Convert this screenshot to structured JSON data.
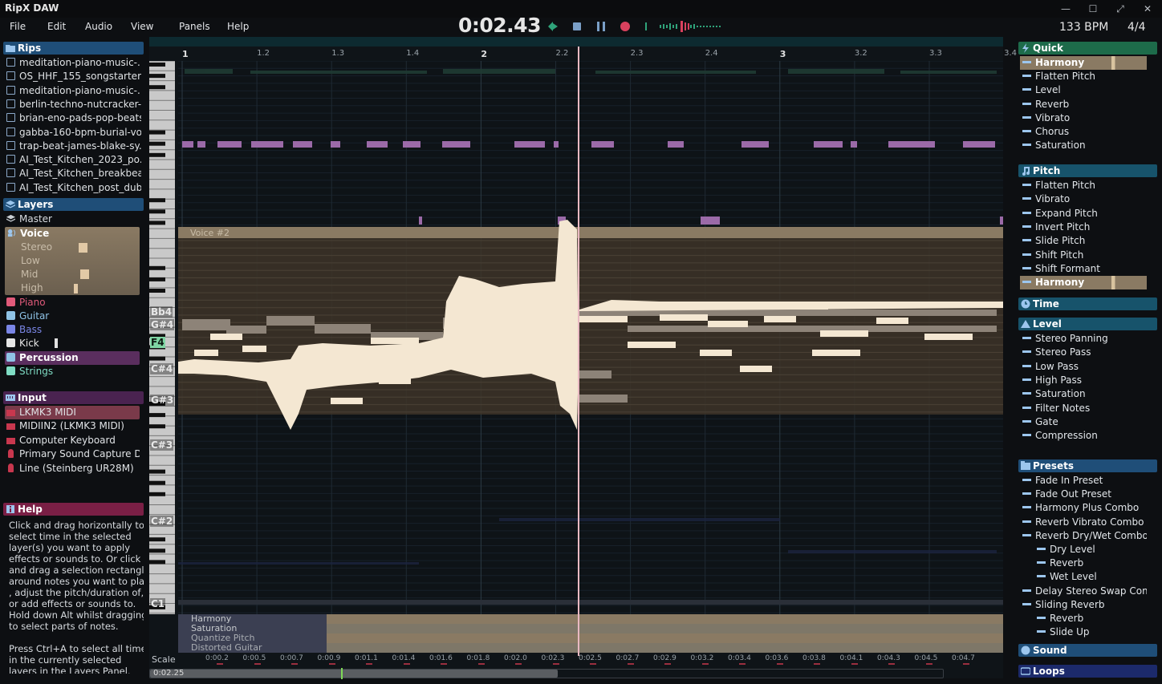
{
  "window": {
    "title": "RipX DAW",
    "buttons": [
      "—",
      "☐",
      "⤢",
      "✕"
    ]
  },
  "menu": [
    "File",
    "Edit",
    "Audio",
    "View",
    "Panels",
    "Help"
  ],
  "transport": {
    "time": "0:02.43",
    "bpm": "133 BPM",
    "time_signature": "4/4"
  },
  "left": {
    "rips_header": "Rips",
    "rips": [
      "meditation-piano-music-...",
      "OS_HHF_155_songstarter...",
      "meditation-piano-music-...",
      "berlin-techno-nutcracker-...",
      "brian-eno-pads-pop-beats...",
      "gabba-160-bpm-burial-vo...",
      "trap-beat-james-blake-sy...",
      "AI_Test_Kitchen_2023_po...",
      "AI_Test_Kitchen_breakbea...",
      "AI_Test_Kitchen_post_dub..."
    ],
    "layers_header": "Layers",
    "layers": {
      "master": "Master",
      "voice": "Voice",
      "voice_sub": [
        "Stereo",
        "Low",
        "Mid",
        "High"
      ],
      "others": [
        {
          "label": "Piano",
          "color": "#e05a7a"
        },
        {
          "label": "Guitar",
          "color": "#8fc3e6"
        },
        {
          "label": "Bass",
          "color": "#7a86e6"
        },
        {
          "label": "Kick",
          "color": "#e6e6e6"
        },
        {
          "label": "Percussion",
          "color": "#ffffff"
        },
        {
          "label": "Strings",
          "color": "#7fdcc4"
        }
      ]
    },
    "input_header": "Input",
    "inputs": [
      "LKMK3 MIDI",
      "MIDIIN2 (LKMK3 MIDI)",
      "Computer Keyboard",
      "Primary Sound Capture Dr...",
      "Line (Steinberg UR28M)"
    ],
    "help_header": "Help",
    "help_text": [
      "Click and drag horizontally to",
      "select time in the selected",
      "layer(s) you want to apply",
      "effects or sounds to. Or click",
      "and drag a selection rectangle",
      "around notes you want to play",
      ", adjust the pitch/duration of,",
      "or add effects or sounds to.",
      "Hold down Alt whilst dragging",
      "to select parts of notes.",
      "",
      "Press Ctrl+A to select all time",
      "in the currently selected",
      "layers in the Layers Panel."
    ]
  },
  "right": {
    "quick_header": "Quick",
    "quick": [
      "Harmony",
      "Flatten Pitch",
      "Level",
      "Reverb",
      "Vibrato",
      "Chorus",
      "Saturation"
    ],
    "pitch_header": "Pitch",
    "pitch": [
      "Flatten Pitch",
      "Vibrato",
      "Expand Pitch",
      "Invert Pitch",
      "Slide Pitch",
      "Shift Pitch",
      "Shift Formant",
      "Harmony"
    ],
    "time_header": "Time",
    "level_header": "Level",
    "level": [
      "Stereo Panning",
      "Stereo Pass",
      "Low Pass",
      "High Pass",
      "Saturation",
      "Filter Notes",
      "Gate",
      "Compression"
    ],
    "presets_header": "Presets",
    "presets": [
      {
        "label": "Fade In Preset",
        "indent": 0
      },
      {
        "label": "Fade Out Preset",
        "indent": 0
      },
      {
        "label": "Harmony Plus Combo",
        "indent": 0
      },
      {
        "label": "Reverb Vibrato Combo",
        "indent": 0
      },
      {
        "label": "Reverb Dry/Wet Combo",
        "indent": 0
      },
      {
        "label": "Dry Level",
        "indent": 1
      },
      {
        "label": "Reverb",
        "indent": 1
      },
      {
        "label": "Wet Level",
        "indent": 1
      },
      {
        "label": "Delay Stereo Swap Combo",
        "indent": 0
      },
      {
        "label": "Sliding Reverb",
        "indent": 0
      },
      {
        "label": "Reverb",
        "indent": 1
      },
      {
        "label": "Slide Up",
        "indent": 1
      }
    ],
    "sound_header": "Sound",
    "loops_header": "Loops"
  },
  "editor": {
    "ruler": [
      {
        "label": "1",
        "bar": true
      },
      {
        "label": "1.2",
        "bar": false
      },
      {
        "label": "1.3",
        "bar": false
      },
      {
        "label": "1.4",
        "bar": false
      },
      {
        "label": "2",
        "bar": true
      },
      {
        "label": "2.2",
        "bar": false
      },
      {
        "label": "2.3",
        "bar": false
      },
      {
        "label": "2.4",
        "bar": false
      },
      {
        "label": "3",
        "bar": true
      },
      {
        "label": "3.2",
        "bar": false
      },
      {
        "label": "3.3",
        "bar": false
      },
      {
        "label": "3.4",
        "bar": false
      }
    ],
    "note_labels": [
      "Bb4",
      "G#4",
      "F4",
      "C#4",
      "G#3",
      "C#3",
      "C#2",
      "C1"
    ],
    "voice_label": "Voice #2",
    "lanes": [
      "Harmony",
      "Saturation",
      "Quantize Pitch",
      "Distorted Guitar"
    ],
    "timeline": [
      "0:00.2",
      "0:00.5",
      "0:00.7",
      "0:00.9",
      "0:01.1",
      "0:01.4",
      "0:01.6",
      "0:01.8",
      "0:02.0",
      "0:02.3",
      "0:02.5",
      "0:02.7",
      "0:02.9",
      "0:03.2",
      "0:03.4",
      "0:03.6",
      "0:03.8",
      "0:04.1",
      "0:04.3",
      "0:04.5",
      "0:04.7"
    ],
    "scale_label": "Scale",
    "scroll_time": "0:02.25"
  }
}
